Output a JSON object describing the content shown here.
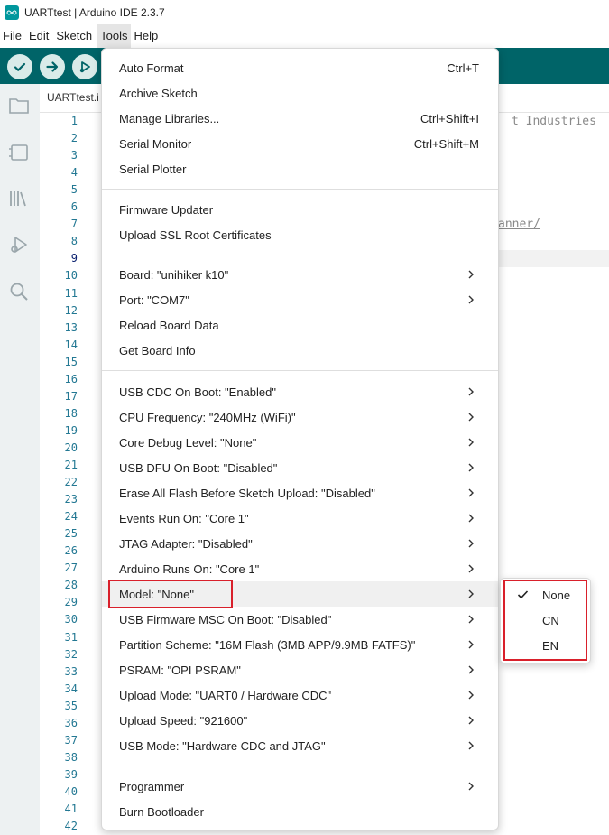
{
  "window": {
    "title": "UARTtest | Arduino IDE 2.3.7"
  },
  "menubar": {
    "items": [
      "File",
      "Edit",
      "Sketch",
      "Tools",
      "Help"
    ],
    "active": "Tools"
  },
  "toolbar": {
    "verify_icon": "check-icon",
    "upload_icon": "arrow-right-icon",
    "debug_icon": "debug-icon",
    "accent": "#006468"
  },
  "sidebar": {
    "icons": [
      "folder-icon",
      "board-icon",
      "library-icon",
      "debug-icon",
      "search-icon"
    ]
  },
  "editor": {
    "tab_label": "UARTtest.i",
    "line_numbers": [
      "1",
      "2",
      "3",
      "4",
      "5",
      "6",
      "7",
      "8",
      "9",
      "10",
      "11",
      "12",
      "13",
      "14",
      "15",
      "16",
      "17",
      "18",
      "19",
      "20",
      "21",
      "22",
      "23",
      "24",
      "25",
      "26",
      "27",
      "28",
      "29",
      "30",
      "31",
      "32",
      "33",
      "34",
      "35",
      "36",
      "37",
      "38",
      "39",
      "40",
      "41",
      "42"
    ],
    "current_line": "9",
    "visible_fragments": {
      "line1": "t Industries",
      "line7": "anner/"
    }
  },
  "tools_menu": {
    "group1": [
      {
        "label": "Auto Format",
        "shortcut": "Ctrl+T"
      },
      {
        "label": "Archive Sketch",
        "shortcut": ""
      },
      {
        "label": "Manage Libraries...",
        "shortcut": "Ctrl+Shift+I"
      },
      {
        "label": "Serial Monitor",
        "shortcut": "Ctrl+Shift+M"
      },
      {
        "label": "Serial Plotter",
        "shortcut": ""
      }
    ],
    "group2": [
      {
        "label": "Firmware Updater"
      },
      {
        "label": "Upload SSL Root Certificates"
      }
    ],
    "group3": [
      {
        "label": "Board: \"unihiker k10\"",
        "submenu": true
      },
      {
        "label": "Port: \"COM7\"",
        "submenu": true
      },
      {
        "label": "Reload Board Data",
        "submenu": false
      },
      {
        "label": "Get Board Info",
        "submenu": false
      }
    ],
    "group4": [
      {
        "label": "USB CDC On Boot: \"Enabled\""
      },
      {
        "label": "CPU Frequency: \"240MHz (WiFi)\""
      },
      {
        "label": "Core Debug Level: \"None\""
      },
      {
        "label": "USB DFU On Boot: \"Disabled\""
      },
      {
        "label": "Erase All Flash Before Sketch Upload: \"Disabled\""
      },
      {
        "label": "Events Run On: \"Core 1\""
      },
      {
        "label": "JTAG Adapter: \"Disabled\""
      },
      {
        "label": "Arduino Runs On: \"Core 1\""
      },
      {
        "label": "Model: \"None\"",
        "hover": true
      },
      {
        "label": "USB Firmware MSC On Boot: \"Disabled\""
      },
      {
        "label": "Partition Scheme: \"16M Flash (3MB APP/9.9MB FATFS)\""
      },
      {
        "label": "PSRAM: \"OPI PSRAM\""
      },
      {
        "label": "Upload Mode: \"UART0 / Hardware CDC\""
      },
      {
        "label": "Upload Speed: \"921600\""
      },
      {
        "label": "USB Mode: \"Hardware CDC and JTAG\""
      }
    ],
    "group5": [
      {
        "label": "Programmer",
        "submenu": true
      },
      {
        "label": "Burn Bootloader",
        "submenu": false
      }
    ]
  },
  "model_submenu": {
    "options": [
      "None",
      "CN",
      "EN"
    ],
    "selected": "None"
  },
  "highlight_color": "#d9202b"
}
